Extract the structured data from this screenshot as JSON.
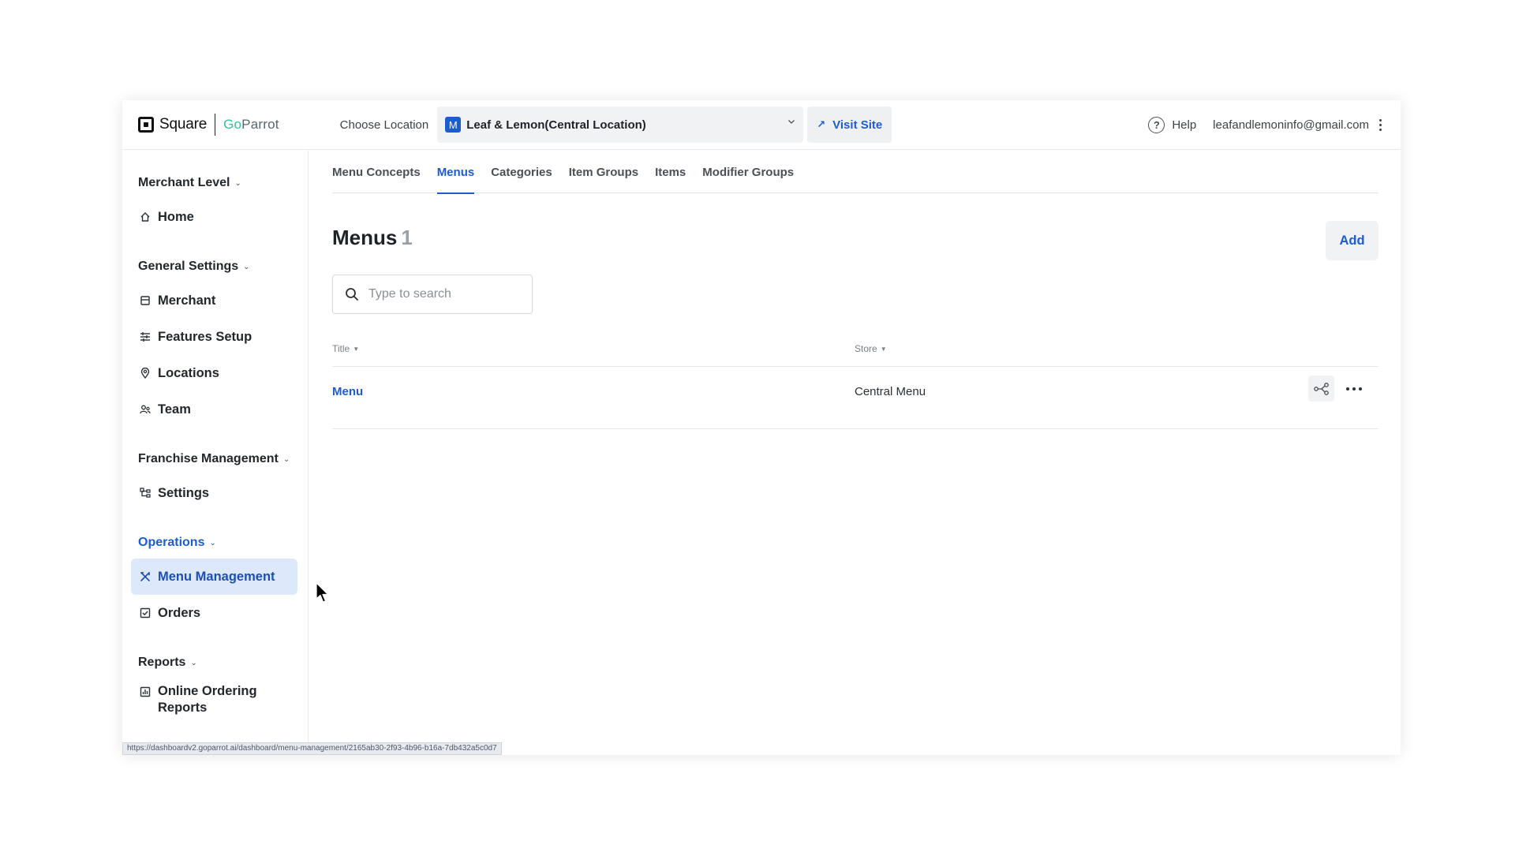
{
  "brand": {
    "square": "Square",
    "goparrot_go": "Go",
    "goparrot_rest": "Parrot"
  },
  "header": {
    "choose_location_label": "Choose Location",
    "location_badge": "M",
    "location_name": "Leaf & Lemon(Central Location)",
    "visit_site": "Visit Site",
    "help": "Help",
    "email": "leafandlemoninfo@gmail.com"
  },
  "sidebar": {
    "sections": [
      {
        "title": "Merchant Level",
        "items": [
          {
            "label": "Home",
            "icon": "home-icon"
          }
        ]
      },
      {
        "title": "General Settings",
        "items": [
          {
            "label": "Merchant",
            "icon": "store-icon"
          },
          {
            "label": "Features Setup",
            "icon": "sliders-icon"
          },
          {
            "label": "Locations",
            "icon": "location-pin-icon"
          },
          {
            "label": "Team",
            "icon": "team-icon"
          }
        ]
      },
      {
        "title": "Franchise Management",
        "items": [
          {
            "label": "Settings",
            "icon": "hierarchy-icon"
          }
        ]
      },
      {
        "title": "Operations",
        "items": [
          {
            "label": "Menu Management",
            "icon": "utensils-icon",
            "selected": true
          },
          {
            "label": "Orders",
            "icon": "checkbox-icon"
          }
        ]
      },
      {
        "title": "Reports",
        "items": [
          {
            "label": "Online Ordering Reports",
            "icon": "report-icon"
          }
        ]
      }
    ]
  },
  "tabs": [
    "Menu Concepts",
    "Menus",
    "Categories",
    "Item Groups",
    "Items",
    "Modifier Groups"
  ],
  "active_tab": "Menus",
  "page": {
    "title": "Menus",
    "count": "1",
    "add_label": "Add"
  },
  "search": {
    "placeholder": "Type to search",
    "value": ""
  },
  "table": {
    "columns": [
      "Title",
      "Store"
    ],
    "rows": [
      {
        "title": "Menu",
        "store": "Central Menu"
      }
    ]
  },
  "status_url": "https://dashboardv2.goparrot.ai/dashboard/menu-management/2165ab30-2f93-4b96-b16a-7db432a5c0d7",
  "colors": {
    "accent": "#1d5ccf",
    "selected_bg": "#dde9fb",
    "brand_green": "#35c3a0"
  }
}
